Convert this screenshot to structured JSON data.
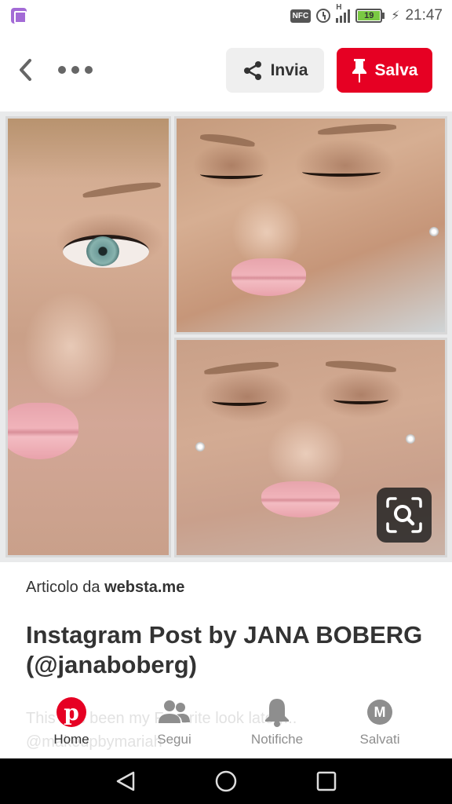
{
  "status_bar": {
    "nfc": "NFC",
    "network": "H",
    "battery": "19",
    "time": "21:47"
  },
  "toolbar": {
    "send_label": "Invia",
    "save_label": "Salva"
  },
  "pin": {
    "source_prefix": "Articolo da",
    "source_domain": "websta.me",
    "title": "Instagram Post by JANA BOBERG (@janaboberg)",
    "description_fragment": "This has been my Favorite look lately... @makeupbymariah"
  },
  "bottom_nav": {
    "items": [
      {
        "label": "Home",
        "icon": "pinterest-logo-icon",
        "active": true
      },
      {
        "label": "Segui",
        "icon": "people-icon",
        "active": false
      },
      {
        "label": "Notifiche",
        "icon": "bell-icon",
        "active": false
      },
      {
        "label": "Salvati",
        "icon": "avatar-icon",
        "avatar_letter": "M",
        "active": false
      }
    ]
  },
  "colors": {
    "brand_red": "#e60023",
    "send_bg": "#efefef",
    "text": "#333333",
    "nav_inactive": "#8e8e8e"
  }
}
